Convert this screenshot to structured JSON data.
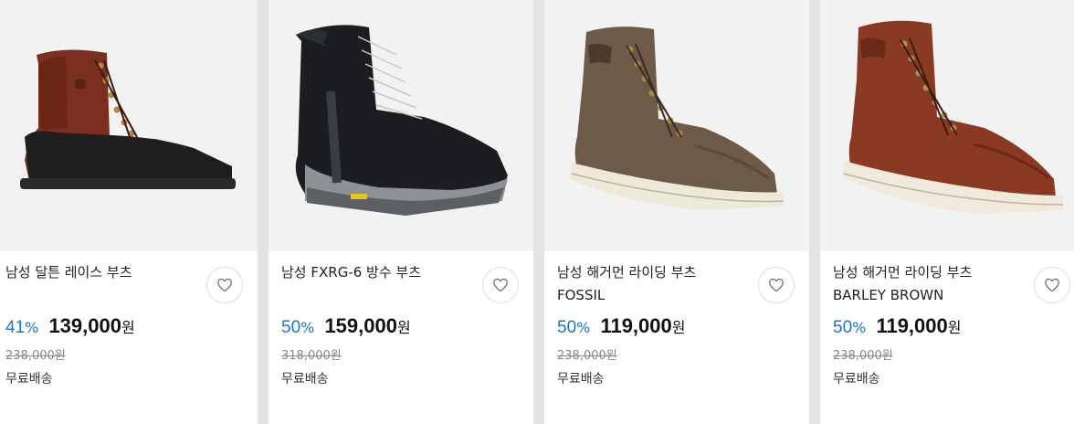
{
  "products": [
    {
      "name": "남성 달튼 레이스 부츠",
      "discount": "41",
      "discount_unit": "%",
      "price": "139,000",
      "currency": "원",
      "original_price": "238,000원",
      "shipping": "무료배송",
      "wishlist_icon": "heart-outline-icon"
    },
    {
      "name": "남성 FXRG-6 방수 부츠",
      "discount": "50",
      "discount_unit": "%",
      "price": "159,000",
      "currency": "원",
      "original_price": "318,000원",
      "shipping": "무료배송",
      "wishlist_icon": "heart-outline-icon"
    },
    {
      "name": "남성 해거먼 라이딩 부츠\nFOSSIL",
      "discount": "50",
      "discount_unit": "%",
      "price": "119,000",
      "currency": "원",
      "original_price": "238,000원",
      "shipping": "무료배송",
      "wishlist_icon": "heart-outline-icon"
    },
    {
      "name": "남성 해거먼 라이딩 부츠\nBARLEY BROWN",
      "discount": "50",
      "discount_unit": "%",
      "price": "119,000",
      "currency": "원",
      "original_price": "238,000원",
      "shipping": "무료배송",
      "wishlist_icon": "heart-outline-icon"
    }
  ],
  "colors": {
    "discount": "#1a73d6",
    "background": "#e3e3e3",
    "image_bg": "#f2f2f2"
  }
}
